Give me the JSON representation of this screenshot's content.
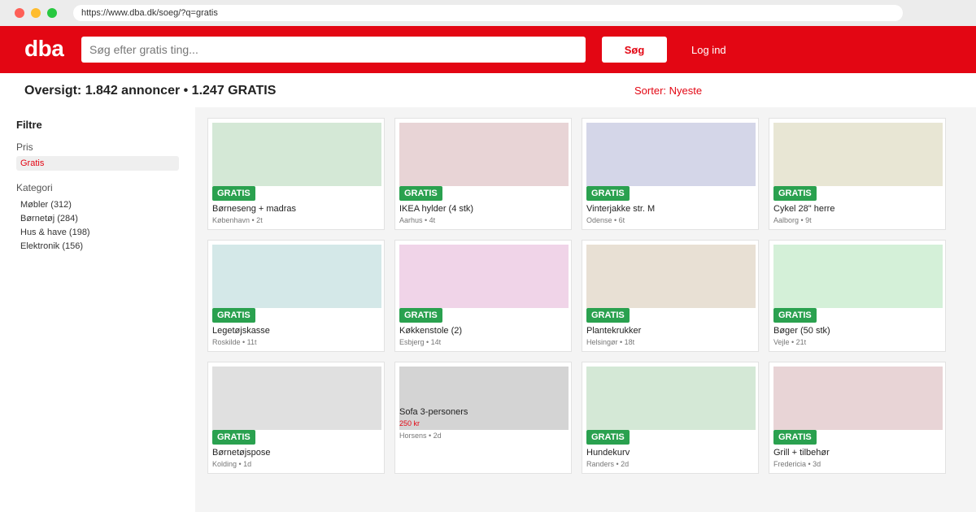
{
  "browser": {
    "url": "https://www.dba.dk/soeg/?q=gratis"
  },
  "header": {
    "logo": "dba",
    "search_placeholder": "Søg efter gratis ting...",
    "search_button": "Søg",
    "login": "Log ind",
    "brand_color": "#e30613"
  },
  "summary": {
    "text": "Oversigt: 1.842 annoncer • 1.247 GRATIS",
    "sort": "Sorter: Nyeste"
  },
  "sidebar": {
    "title": "Filtre",
    "price_label": "Pris",
    "price_option": "Gratis",
    "category_label": "Kategori",
    "categories": [
      "Møbler (312)",
      "Børnetøj (284)",
      "Hus & have (198)",
      "Elektronik (156)"
    ]
  },
  "listings": [
    {
      "badge": "GRATIS",
      "title": "Børneseng + madras",
      "meta": "København • 2t",
      "image_color": "#d4e8d6"
    },
    {
      "badge": "GRATIS",
      "title": "IKEA hylder (4 stk)",
      "meta": "Aarhus • 4t",
      "image_color": "#e8d4d6"
    },
    {
      "badge": "GRATIS",
      "title": "Vinterjakke str. M",
      "meta": "Odense • 6t",
      "image_color": "#d4d6e8"
    },
    {
      "badge": "GRATIS",
      "title": "Cykel 28\" herre",
      "meta": "Aalborg • 9t",
      "image_color": "#e8e6d4"
    },
    {
      "badge": "GRATIS",
      "title": "Legetøjskasse",
      "meta": "Roskilde • 11t",
      "image_color": "#d4e8e8"
    },
    {
      "badge": "GRATIS",
      "title": "Køkkenstole (2)",
      "meta": "Esbjerg • 14t",
      "image_color": "#f0d4e8"
    },
    {
      "badge": "GRATIS",
      "title": "Plantekrukker",
      "meta": "Helsingør • 18t",
      "image_color": "#e8e0d4"
    },
    {
      "badge": "GRATIS",
      "title": "Bøger (50 stk)",
      "meta": "Vejle • 21t",
      "image_color": "#d4f0d8"
    },
    {
      "badge": "GRATIS",
      "title": "Børnetøjspose",
      "meta": "Kolding • 1d",
      "image_color": "#e0e0e0"
    },
    {
      "title": "Sofa 3-personers",
      "price": "250 kr",
      "meta": "Horsens • 2d",
      "image_color": "#d4d4d4"
    },
    {
      "badge": "GRATIS",
      "title": "Hundekurv",
      "meta": "Randers • 2d",
      "image_color": "#d4e8d6"
    },
    {
      "badge": "GRATIS",
      "title": "Grill + tilbehør",
      "meta": "Fredericia • 3d",
      "image_color": "#e8d4d6"
    }
  ]
}
